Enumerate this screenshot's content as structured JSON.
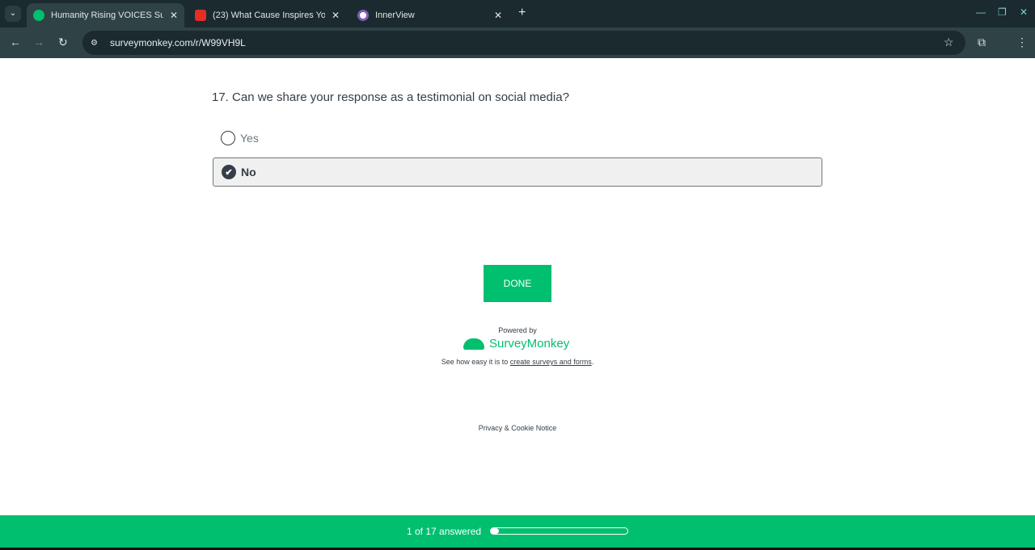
{
  "browser": {
    "tabs": [
      {
        "title": "Humanity Rising VOICES Surve",
        "active": true,
        "favicon_color": "#00bf6f"
      },
      {
        "title": "(23) What Cause Inspires You |",
        "active": false,
        "favicon_color": "#e52d27"
      },
      {
        "title": "InnerView",
        "active": false,
        "favicon_color": "#7d5bbe"
      }
    ],
    "url": "surveymonkey.com/r/W99VH9L"
  },
  "survey": {
    "question": "17. Can we share your response as a testimonial on social media?",
    "options": [
      {
        "label": "Yes",
        "selected": false
      },
      {
        "label": "No",
        "selected": true
      }
    ],
    "done_label": "DONE",
    "powered_by": "Powered by",
    "brand": "SurveyMonkey",
    "promo_prefix": "See how easy it is to ",
    "promo_link": "create surveys and forms",
    "promo_suffix": ".",
    "privacy": "Privacy & Cookie Notice"
  },
  "progress": {
    "label": "1 of 17 answered",
    "answered": 1,
    "total": 17
  }
}
